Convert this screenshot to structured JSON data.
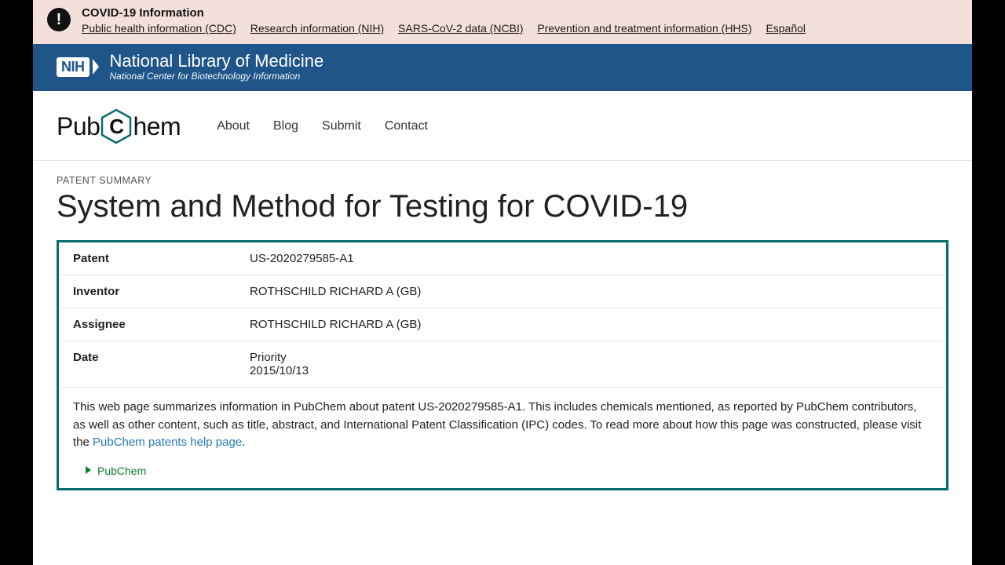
{
  "covid": {
    "title": "COVID-19 Information",
    "links": [
      "Public health information (CDC)",
      "Research information (NIH)",
      "SARS-CoV-2 data (NCBI)",
      "Prevention and treatment information (HHS)",
      "Español"
    ]
  },
  "nlm": {
    "badge": "NIH",
    "title": "National Library of Medicine",
    "sub": "National Center for Biotechnology Information"
  },
  "pubchem": {
    "logo_prefix": "Pub",
    "logo_c": "C",
    "logo_suffix": "hem",
    "nav": [
      "About",
      "Blog",
      "Submit",
      "Contact"
    ]
  },
  "page": {
    "kicker": "PATENT SUMMARY",
    "title": "System and Method for Testing for COVID-19"
  },
  "summary": {
    "rows": [
      {
        "label": "Patent",
        "value": "US-2020279585-A1"
      },
      {
        "label": "Inventor",
        "value": "ROTHSCHILD RICHARD A (GB)"
      },
      {
        "label": "Assignee",
        "value": "ROTHSCHILD RICHARD A (GB)"
      },
      {
        "label": "Date",
        "value": "Priority\n2015/10/13"
      }
    ],
    "desc_1": "This web page summarizes information in PubChem about patent US-2020279585-A1. This includes chemicals mentioned, as reported by PubChem contributors, as well as other content, such as title, abstract, and International Patent Classification (IPC) codes. To read more about how this page was constructed, please visit the ",
    "desc_link": "PubChem patents help page",
    "desc_2": ".",
    "source": "PubChem"
  }
}
